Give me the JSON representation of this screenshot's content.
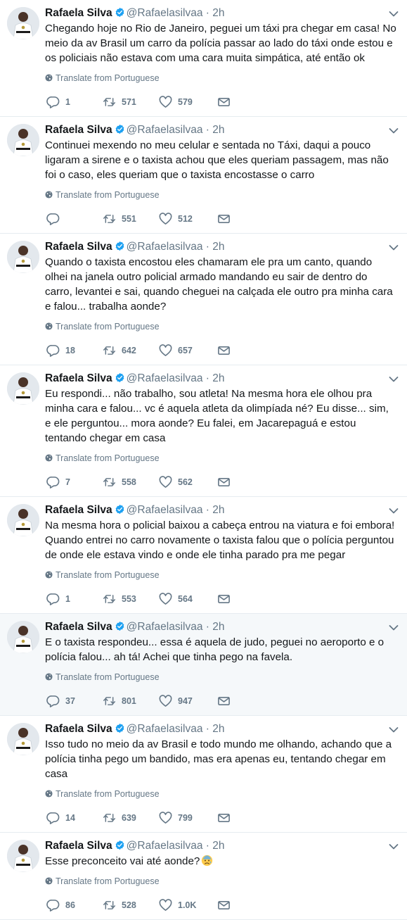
{
  "translate_label": "Translate from Portuguese",
  "colors": {
    "text": "#14171a",
    "muted": "#657786",
    "verified": "#1da1f2",
    "divider": "#e6ecf0",
    "highlight": "#f5f8fa"
  },
  "icons": [
    "avatar",
    "verified-badge-icon",
    "chevron-down-icon",
    "globe-icon",
    "reply-icon",
    "retweet-icon",
    "heart-icon",
    "envelope-icon",
    "anxious-face-emoji"
  ],
  "tweets": [
    {
      "name": "Rafaela Silva",
      "handle": "@Rafaelasilvaa",
      "dot": "·",
      "time": "2h",
      "text": "Chegando hoje no Rio de Janeiro, peguei um táxi pra chegar em casa! No meio da av Brasil um carro da polícia passar ao lado do táxi onde estou e os policiais não estava com uma cara muita simpática, até então ok",
      "replies": "1",
      "retweets": "571",
      "likes": "579"
    },
    {
      "name": "Rafaela Silva",
      "handle": "@Rafaelasilvaa",
      "dot": "·",
      "time": "2h",
      "text": "Continuei mexendo no meu celular e sentada no Táxi, daqui a pouco ligaram a sirene e o taxista achou que eles queriam passagem, mas não foi o caso, eles queriam que o taxista encostasse o carro",
      "replies": "",
      "retweets": "551",
      "likes": "512"
    },
    {
      "name": "Rafaela Silva",
      "handle": "@Rafaelasilvaa",
      "dot": "·",
      "time": "2h",
      "text": "Quando o taxista encostou eles chamaram ele pra um canto, quando olhei na janela outro policial armado mandando eu sair de dentro do carro, levantei e sai, quando cheguei na calçada ele outro pra minha cara e falou... trabalha aonde?",
      "replies": "18",
      "retweets": "642",
      "likes": "657"
    },
    {
      "name": "Rafaela Silva",
      "handle": "@Rafaelasilvaa",
      "dot": "·",
      "time": "2h",
      "text": "Eu respondi... não trabalho, sou atleta! Na mesma hora ele olhou pra minha cara e falou... vc é aquela atleta da olimpíada né? Eu disse... sim, e ele perguntou... mora aonde? Eu falei, em Jacarepaguá e estou tentando chegar em casa",
      "replies": "7",
      "retweets": "558",
      "likes": "562"
    },
    {
      "name": "Rafaela Silva",
      "handle": "@Rafaelasilvaa",
      "dot": "·",
      "time": "2h",
      "text": "Na mesma hora o policial baixou a cabeça entrou na viatura e foi embora! Quando entrei no carro novamente o taxista falou que o polícia perguntou de onde ele estava vindo e onde ele tinha parado pra me pegar",
      "replies": "1",
      "retweets": "553",
      "likes": "564"
    },
    {
      "name": "Rafaela Silva",
      "handle": "@Rafaelasilvaa",
      "dot": "·",
      "time": "2h",
      "text": "E o taxista respondeu... essa é aquela de judo, peguei no aeroporto e o polícia falou... ah tá! Achei que tinha pego na favela.",
      "replies": "37",
      "retweets": "801",
      "likes": "947"
    },
    {
      "name": "Rafaela Silva",
      "handle": "@Rafaelasilvaa",
      "dot": "·",
      "time": "2h",
      "text": "Isso tudo no meio da av Brasil e todo mundo me olhando, achando que a polícia tinha pego um bandido, mas era apenas eu, tentando chegar em casa",
      "replies": "14",
      "retweets": "639",
      "likes": "799"
    },
    {
      "name": "Rafaela Silva",
      "handle": "@Rafaelasilvaa",
      "dot": "·",
      "time": "2h",
      "text": "Esse preconceito vai até aonde?",
      "replies": "86",
      "retweets": "528",
      "likes": "1.0K"
    }
  ]
}
